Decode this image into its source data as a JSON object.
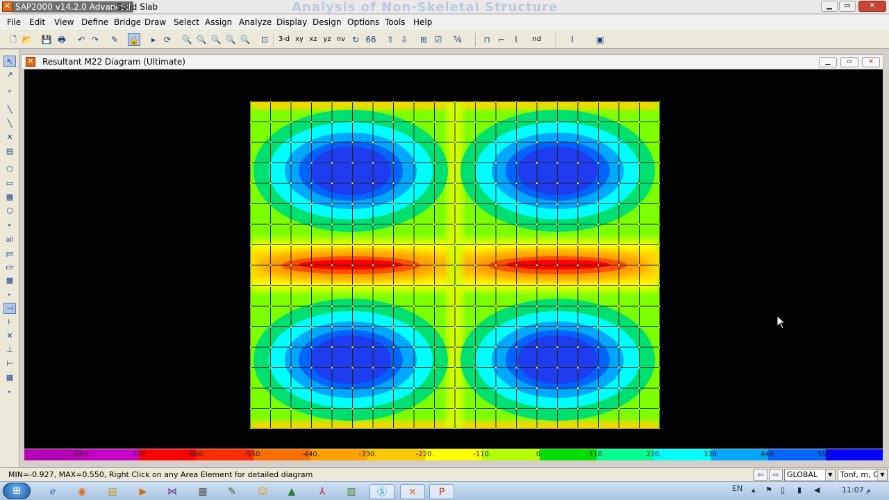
{
  "window": {
    "app_name": "SAP2000 v14.2.0 Advanced",
    "doc_name": "- Solid Slab",
    "background_title": "Analysis of Non-Skeletal Structure",
    "minimize": "▁",
    "maximize": "▭",
    "close": "✕"
  },
  "menu": [
    "File",
    "Edit",
    "View",
    "Define",
    "Bridge",
    "Draw",
    "Select",
    "Assign",
    "Analyze",
    "Display",
    "Design",
    "Options",
    "Tools",
    "Help"
  ],
  "toolbar": {
    "view_3d": "3-d",
    "view_xy": "xy",
    "view_xz": "xz",
    "view_yz": "yz",
    "view_nv": "nv",
    "view_nd": "nd"
  },
  "left_toolbar": {
    "all": "all",
    "ps": "ps",
    "clr": "clr"
  },
  "diagram_window": {
    "title": "Resultant M22 Diagram   (Ultimate)"
  },
  "legend": {
    "labels": [
      "-880.",
      "-770.",
      "-660.",
      "-550.",
      "-440.",
      "-330.",
      "-220.",
      "-110.",
      "0.",
      "110.",
      "220.",
      "330.",
      "440.",
      "550."
    ],
    "colors": [
      "#b400b4",
      "#c800c8",
      "#ff0000",
      "#ff2a00",
      "#ff6f00",
      "#ffa000",
      "#ffc800",
      "#ffff00",
      "#b4ff00",
      "#00e000",
      "#00ff90",
      "#00ffff",
      "#00a8ff",
      "#0064ff",
      "#0000ff"
    ]
  },
  "status": {
    "text": "MIN=-0.927, MAX=0.550, Right Click on any Area Element for detailed diagram",
    "coord_system": "GLOBAL",
    "units": "Tonf, m, C"
  },
  "taskbar": {
    "lang": "EN",
    "time": "11:07 م"
  }
}
